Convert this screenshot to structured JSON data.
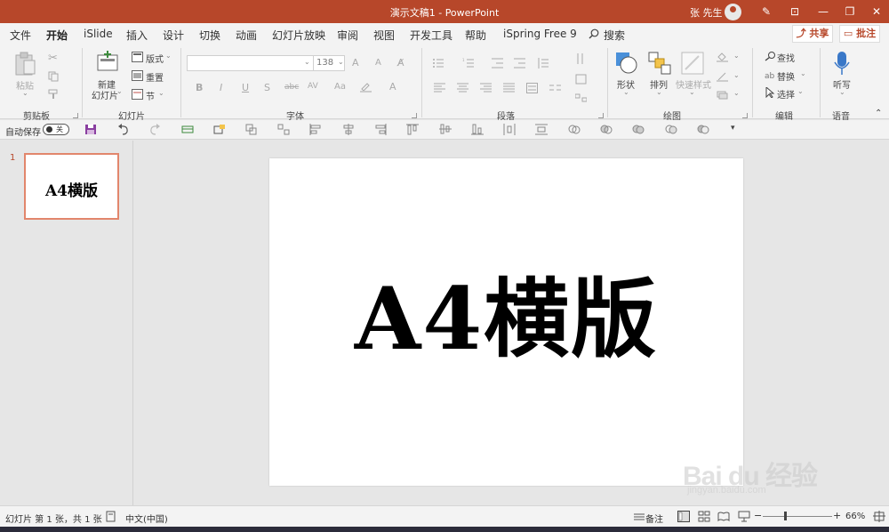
{
  "window": {
    "title": "演示文稿1  -  PowerPoint",
    "user": "张 先生",
    "minimize_glyph": "—",
    "restore_glyph": "❐",
    "close_glyph": "✕"
  },
  "tabs": [
    "文件",
    "开始",
    "iSlide",
    "插入",
    "设计",
    "切换",
    "动画",
    "幻灯片放映",
    "审阅",
    "视图",
    "开发工具",
    "帮助",
    "iSpring Free 9"
  ],
  "active_tab": "开始",
  "search_label": "搜索",
  "share_label": "共享",
  "comment_label": "批注",
  "ribbon": {
    "clipboard": {
      "label": "剪贴板",
      "paste": "粘贴"
    },
    "slides": {
      "label": "幻灯片",
      "new_slide_line1": "新建",
      "new_slide_line2": "幻灯片",
      "layout": "版式",
      "reset": "重置",
      "section": "节"
    },
    "font": {
      "label": "字体",
      "font_name": "",
      "font_size": "138",
      "bold": "B",
      "italic": "I",
      "underline": "U",
      "shadow": "S",
      "strike": "abc",
      "spacing": "AV",
      "case": "Aa",
      "grow": "A",
      "shrink": "A"
    },
    "paragraph": {
      "label": "段落"
    },
    "drawing": {
      "label": "绘图",
      "shapes": "形状",
      "arrange": "排列",
      "quick_styles": "快速样式"
    },
    "editing": {
      "label": "编辑",
      "find": "查找",
      "replace": "替换",
      "select": "选择"
    },
    "voice": {
      "label": "语音",
      "dictate": "听写"
    }
  },
  "qat": {
    "autosave_label": "自动保存",
    "autosave_state": "关"
  },
  "thumbnail": {
    "number": "1",
    "text": "A4横版"
  },
  "slide": {
    "text": "A4横版"
  },
  "status": {
    "slide_info": "幻灯片 第 1 张，共 1 张",
    "language": "中文(中国)",
    "notes": "备注",
    "zoom": "66%"
  },
  "watermark": {
    "logo": "Bai du 经验",
    "url": "jingyan.baidu.com"
  },
  "colors": {
    "accent": "#b7472a",
    "ribbon_bg": "#f3f3f3",
    "workspace_bg": "#e6e6e6",
    "thumb_border": "#e2866c"
  }
}
